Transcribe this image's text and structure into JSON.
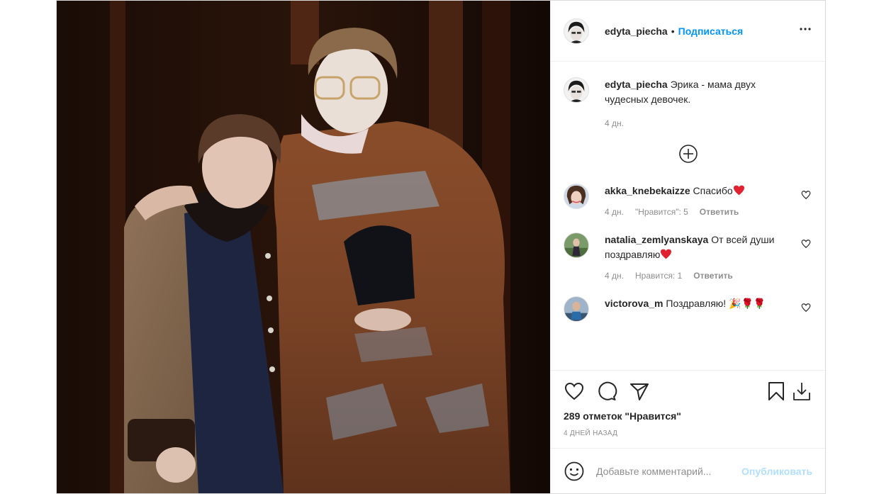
{
  "header": {
    "username": "edyta_piecha",
    "separator": "•",
    "follow_label": "Подписаться",
    "more_icon": "more-dots-icon"
  },
  "caption": {
    "username": "edyta_piecha",
    "text": "Эрика - мама двух чудесных девочек.",
    "time": "4 дн."
  },
  "load_more_icon": "plus-circle-icon",
  "comments": [
    {
      "username": "akka_knebekaizze",
      "text": "Спасибо",
      "emoji": "red-heart",
      "time": "4 дн.",
      "likes": "\"Нравится\": 5",
      "reply": "Ответить"
    },
    {
      "username": "natalia_zemlyanskaya",
      "text": "От всей души поздравляю",
      "emoji": "red-heart",
      "time": "4 дн.",
      "likes": "Нравится: 1",
      "reply": "Ответить"
    },
    {
      "username": "victorova_m",
      "text": "Поздравляю! 🎉🌹🌹",
      "time": "",
      "likes": "",
      "reply": ""
    }
  ],
  "actions": {
    "like_icon": "heart-icon",
    "comment_icon": "comment-icon",
    "share_icon": "paper-plane-icon",
    "save_icon": "bookmark-icon",
    "download_icon": "download-icon"
  },
  "likes_count": "289 отметок \"Нравится\"",
  "post_date": "4 ДНЕЙ НАЗАД",
  "add_comment": {
    "placeholder": "Добавьте комментарий...",
    "publish_label": "Опубликовать",
    "emoji_icon": "smiley-icon"
  },
  "colors": {
    "accent": "#0095f6",
    "publish_disabled": "#b2dffc",
    "heart_red": "#ed4956",
    "muted": "#8e8e8e"
  }
}
